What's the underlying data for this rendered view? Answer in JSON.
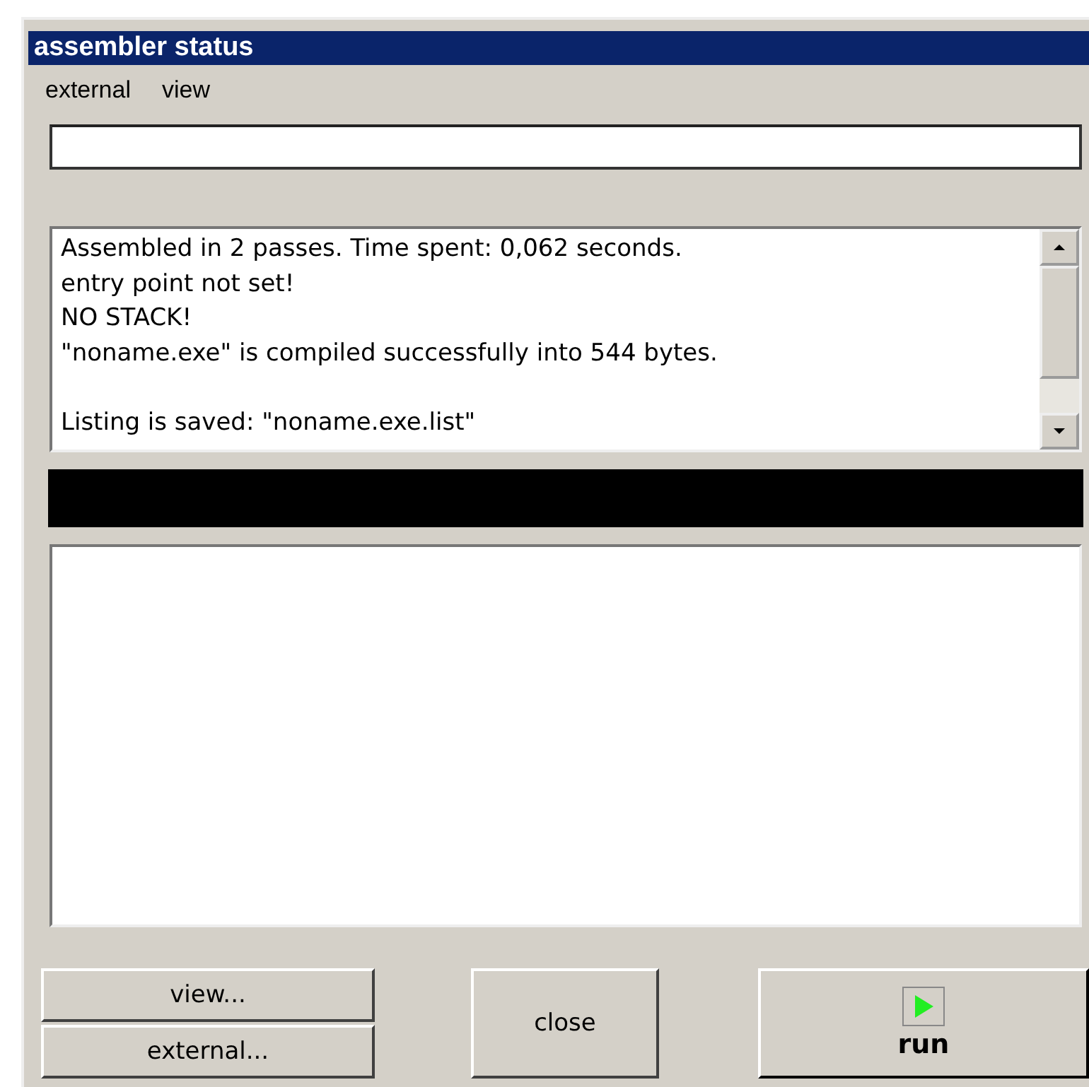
{
  "window": {
    "title": "assembler status"
  },
  "menu": [
    {
      "label": "external"
    },
    {
      "label": "view"
    }
  ],
  "log_paragraphs": [
    {
      "lines": [
        "Assembled in 2 passes. Time spent: 0,062 seconds.",
        "entry point not set!",
        "NO STACK!",
        "\"noname.exe\" is compiled successfully into 544 bytes."
      ]
    },
    {
      "lines": [
        "Listing is saved: \"noname.exe.list\""
      ]
    }
  ],
  "buttons": [
    {
      "label": "view...",
      "kind": "small"
    },
    {
      "label": "external...",
      "kind": "small"
    },
    {
      "label": "close",
      "kind": "medium"
    },
    {
      "label": "run",
      "kind": "run"
    }
  ]
}
